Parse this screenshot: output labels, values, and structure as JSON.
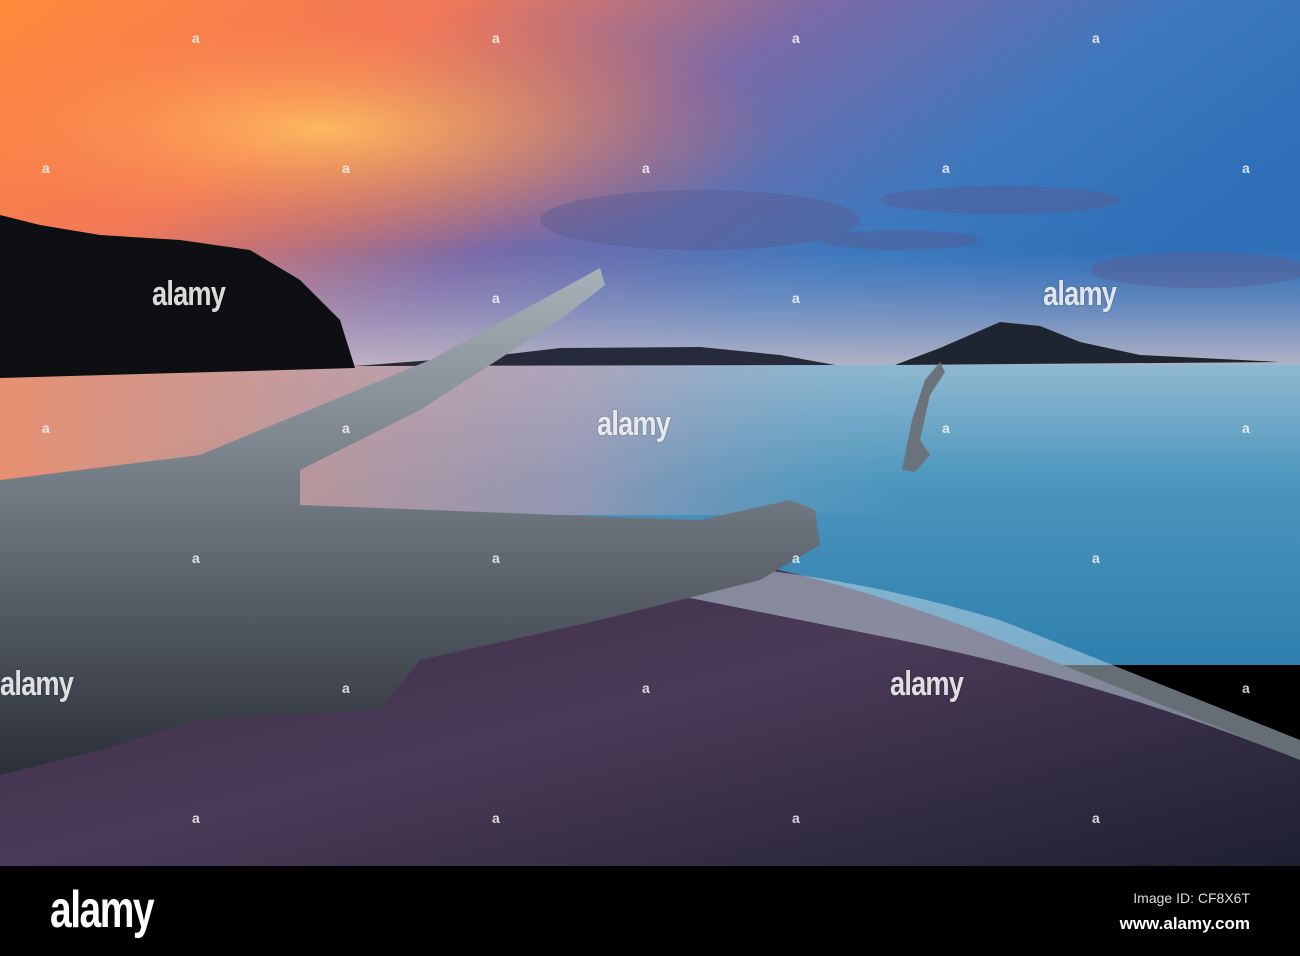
{
  "photo": {
    "description_colors": {
      "sky_top": "#2b6fb8",
      "sky_orange": "#ff8a3c",
      "sea": "#3f8fb5",
      "sand": "#2a2438"
    }
  },
  "watermark": {
    "text": "alamy",
    "mark": "a"
  },
  "footer": {
    "logo": "alamy",
    "image_id": "Image ID: CF8X6T",
    "url": "www.alamy.com"
  }
}
